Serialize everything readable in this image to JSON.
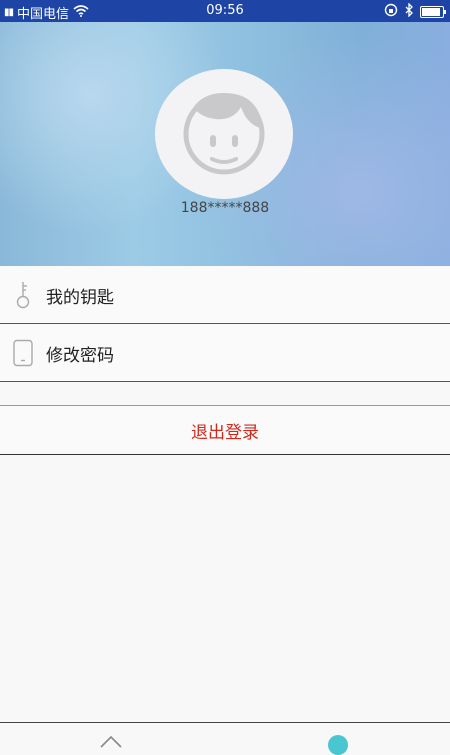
{
  "status_bar": {
    "carrier": "中国电信",
    "time": "09:56"
  },
  "profile": {
    "phone": "188*****888"
  },
  "menu": {
    "items": [
      {
        "label": "我的钥匙",
        "icon": "key-icon"
      },
      {
        "label": "修改密码",
        "icon": "phone-icon"
      }
    ],
    "logout_label": "退出登录"
  },
  "bottom_nav": {
    "items": [
      {
        "icon": "home-icon"
      },
      {
        "icon": "profile-icon"
      }
    ]
  },
  "colors": {
    "status_bar": "#1e44a6",
    "logout_text": "#d02a1e",
    "accent": "#4ac6d0"
  }
}
